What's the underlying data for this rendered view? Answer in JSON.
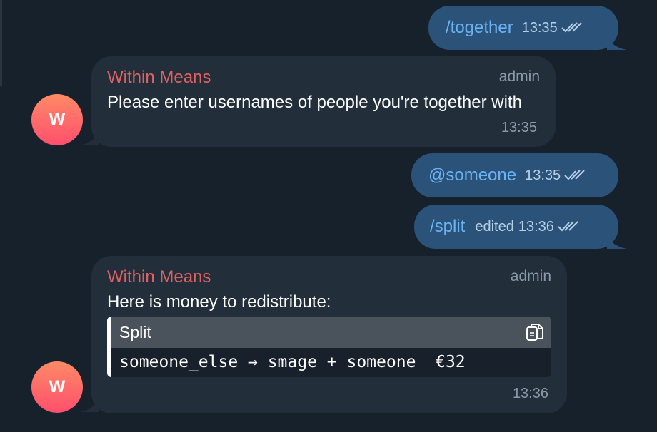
{
  "messages": {
    "out1": {
      "text": "/together",
      "time": "13:35"
    },
    "in1": {
      "sender": "Within Means",
      "role": "admin",
      "text": "Please enter usernames of people you're together with",
      "time": "13:35",
      "avatar": "W"
    },
    "out2": {
      "text": "@someone",
      "time": "13:35"
    },
    "out3": {
      "text": "/split",
      "edited": "edited",
      "time": "13:36"
    },
    "in2": {
      "sender": "Within Means",
      "role": "admin",
      "text": "Here is money to redistribute:",
      "code": {
        "language": "Split",
        "line": "someone_else → smage + someone  €32",
        "copy_icon": "copy-icon"
      },
      "time": "13:36",
      "avatar": "W"
    }
  },
  "colors": {
    "background": "#17212b",
    "outgoing_bubble": "#2b5278",
    "incoming_bubble": "#222e3a",
    "link": "#6ab3f3",
    "sender_name": "#e06161",
    "muted": "#8a9aa9"
  },
  "icons": {
    "read_status": "double-check-icon",
    "copy": "copy-icon"
  }
}
